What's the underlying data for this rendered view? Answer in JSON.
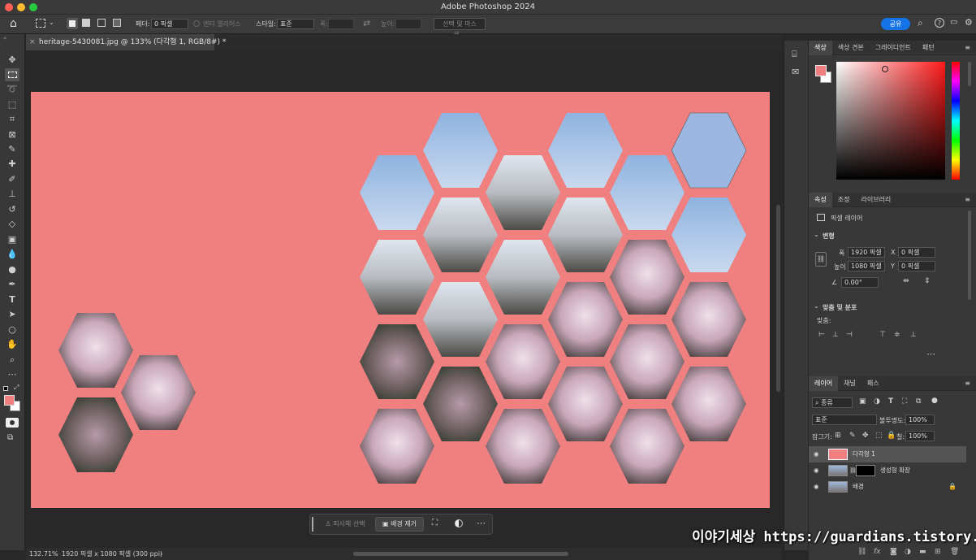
{
  "window": {
    "title": "Adobe Photoshop 2024"
  },
  "options": {
    "feather_label": "페더:",
    "feather_value": "0 픽셀",
    "antialias_label": "앤티 앨리어스",
    "style_label": "스타일:",
    "style_value": "표준",
    "width_label": "폭:",
    "height_label": "높이:",
    "select_mask_label": "선택 및 마스크...",
    "share_label": "공유"
  },
  "document": {
    "tab_title": "heritage-5430081.jpg @ 133% (다각형 1, RGB/8#) *"
  },
  "context_bar": {
    "select_subject": "피사체 선택",
    "remove_bg": "배경 제거"
  },
  "status": {
    "zoom": "132.71%",
    "info": "1920 픽셀 x 1080 픽셀 (300 ppi)"
  },
  "color_panel": {
    "tabs": [
      "색상",
      "색상 견본",
      "그레이디언트",
      "패턴"
    ],
    "foreground": "#f07f7f",
    "background": "#ffffff",
    "picker_hue": "#ff1a1a"
  },
  "properties_panel": {
    "tabs": [
      "속성",
      "조정",
      "라이브러리"
    ],
    "layer_type": "픽셀 레이어",
    "transform_label": "변형",
    "width_label": "폭",
    "width_value": "1920 픽셀",
    "height_label": "높이",
    "height_value": "1080 픽셀",
    "x_label": "X",
    "x_value": "0 픽셀",
    "y_label": "Y",
    "y_value": "0 픽셀",
    "angle_value": "0.00°",
    "align_label": "맞춤 및 분포",
    "align_sub": "맞춤:"
  },
  "layers_panel": {
    "tabs": [
      "레이어",
      "채널",
      "패스"
    ],
    "filter_label": "종류",
    "blend_mode": "표준",
    "opacity_label": "불투명도:",
    "opacity_value": "100%",
    "lock_label": "잠그기:",
    "fill_label": "칠:",
    "fill_value": "100%",
    "layers": [
      {
        "name": "다각형 1",
        "selected": true
      },
      {
        "name": "생성형 확장",
        "selected": false
      },
      {
        "name": "배경",
        "selected": false,
        "locked": true
      }
    ]
  },
  "watermark": {
    "text": "이야기세상 https://guardians.tistory.com"
  }
}
